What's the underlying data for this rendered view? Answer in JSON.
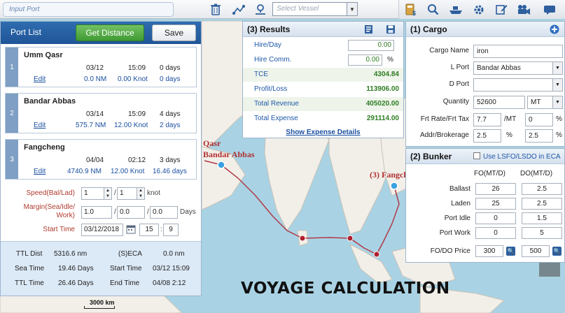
{
  "topbar": {
    "port_input_placeholder": "Input Port",
    "vessel_placeholder": "Select Vessel"
  },
  "left_panel": {
    "title": "Port List",
    "get_distance_label": "Get Distance",
    "save_label": "Save",
    "ports": [
      {
        "index": "1",
        "name": "Umm Qasr",
        "date": "03/12",
        "time": "15:09",
        "days": "0 days",
        "edit": "Edit",
        "distance": "0.0 NM",
        "speed": "0.00 Knot",
        "sea_days": "0 days"
      },
      {
        "index": "2",
        "name": "Bandar Abbas",
        "date": "03/14",
        "time": "15:09",
        "days": "4 days",
        "edit": "Edit",
        "distance": "575.7 NM",
        "speed": "12.00 Knot",
        "sea_days": "2 days"
      },
      {
        "index": "3",
        "name": "Fangcheng",
        "date": "04/04",
        "time": "02:12",
        "days": "3 days",
        "edit": "Edit",
        "distance": "4740.9 NM",
        "speed": "12.00 Knot",
        "sea_days": "16.46 days"
      }
    ],
    "speed_label": "Speed(Bal/Lad)",
    "speed_bal": "1",
    "speed_lad": "1",
    "speed_unit": "knot",
    "margin_label_1": "Margin(Sea/Idle/",
    "margin_label_2": "Work)",
    "margin_sea": "1.0",
    "margin_idle": "0.0",
    "margin_work": "0.0",
    "margin_unit": "Days",
    "start_time_label": "Start Time",
    "start_date": "03/12/2018",
    "start_hour": "15",
    "start_min": "9",
    "summary": {
      "ttl_dist_label": "TTL Dist",
      "ttl_dist": "5316.6 nm",
      "seca_label": "(S)ECA",
      "seca": "0.0 nm",
      "sea_time_label": "Sea Time",
      "sea_time": "19.46 Days",
      "start_time_label": "Start Time",
      "start_time": "03/12 15:09",
      "ttl_time_label": "TTL Time",
      "ttl_time": "26.46 Days",
      "end_time_label": "End Time",
      "end_time": "04/08 2:12"
    }
  },
  "results": {
    "title": "(3)  Results",
    "rows": [
      {
        "label": "Hire/Day",
        "value": "0.00"
      },
      {
        "label": "Hire Comm.",
        "value": "0.00",
        "unit": "%"
      },
      {
        "label": "TCE",
        "value": "4304.84"
      },
      {
        "label": "Profit/Loss",
        "value": "113906.00"
      },
      {
        "label": "Total Revenue",
        "value": "405020.00"
      },
      {
        "label": "Total Expense",
        "value": "291114.00"
      }
    ],
    "show_expense_label": "Show Expense Details"
  },
  "cargo": {
    "title": "(1)  Cargo",
    "cargo_name_label": "Cargo Name",
    "cargo_name": "iron",
    "l_port_label": "L Port",
    "l_port": "Bandar Abbas",
    "d_port_label": "D Port",
    "d_port": "",
    "quantity_label": "Quantity",
    "quantity": "52600",
    "quantity_unit": "MT",
    "frt_label": "Frt Rate/Frt Tax",
    "frt_rate": "7.7",
    "frt_rate_unit": "/MT",
    "frt_tax": "0",
    "frt_tax_unit": "%",
    "addr_label": "Addr/Brokerage",
    "addr": "2.5",
    "addr_unit": "%",
    "brokerage": "2.5",
    "brokerage_unit": "%"
  },
  "bunker": {
    "title": "(2)  Bunker",
    "eca_check_label": "Use LSFO/LSDO in ECA",
    "fo_header": "FO(MT/D)",
    "do_header": "DO(MT/D)",
    "rows": [
      {
        "label": "Ballast",
        "fo": "26",
        "do": "2.5"
      },
      {
        "label": "Laden",
        "fo": "25",
        "do": "2.5"
      },
      {
        "label": "Port Idle",
        "fo": "0",
        "do": "1.5"
      },
      {
        "label": "Port Work",
        "fo": "0",
        "do": "5"
      }
    ],
    "price_label": "FO/DO Price",
    "fo_price": "300",
    "do_price": "500"
  },
  "map": {
    "label_qasr": "Qasr",
    "label_bandar": "Bandar Abbas",
    "label_fangcheng": "(3) Fangch",
    "scale_label": "3000 km"
  },
  "banner": "VOYAGE CALCULATION"
}
